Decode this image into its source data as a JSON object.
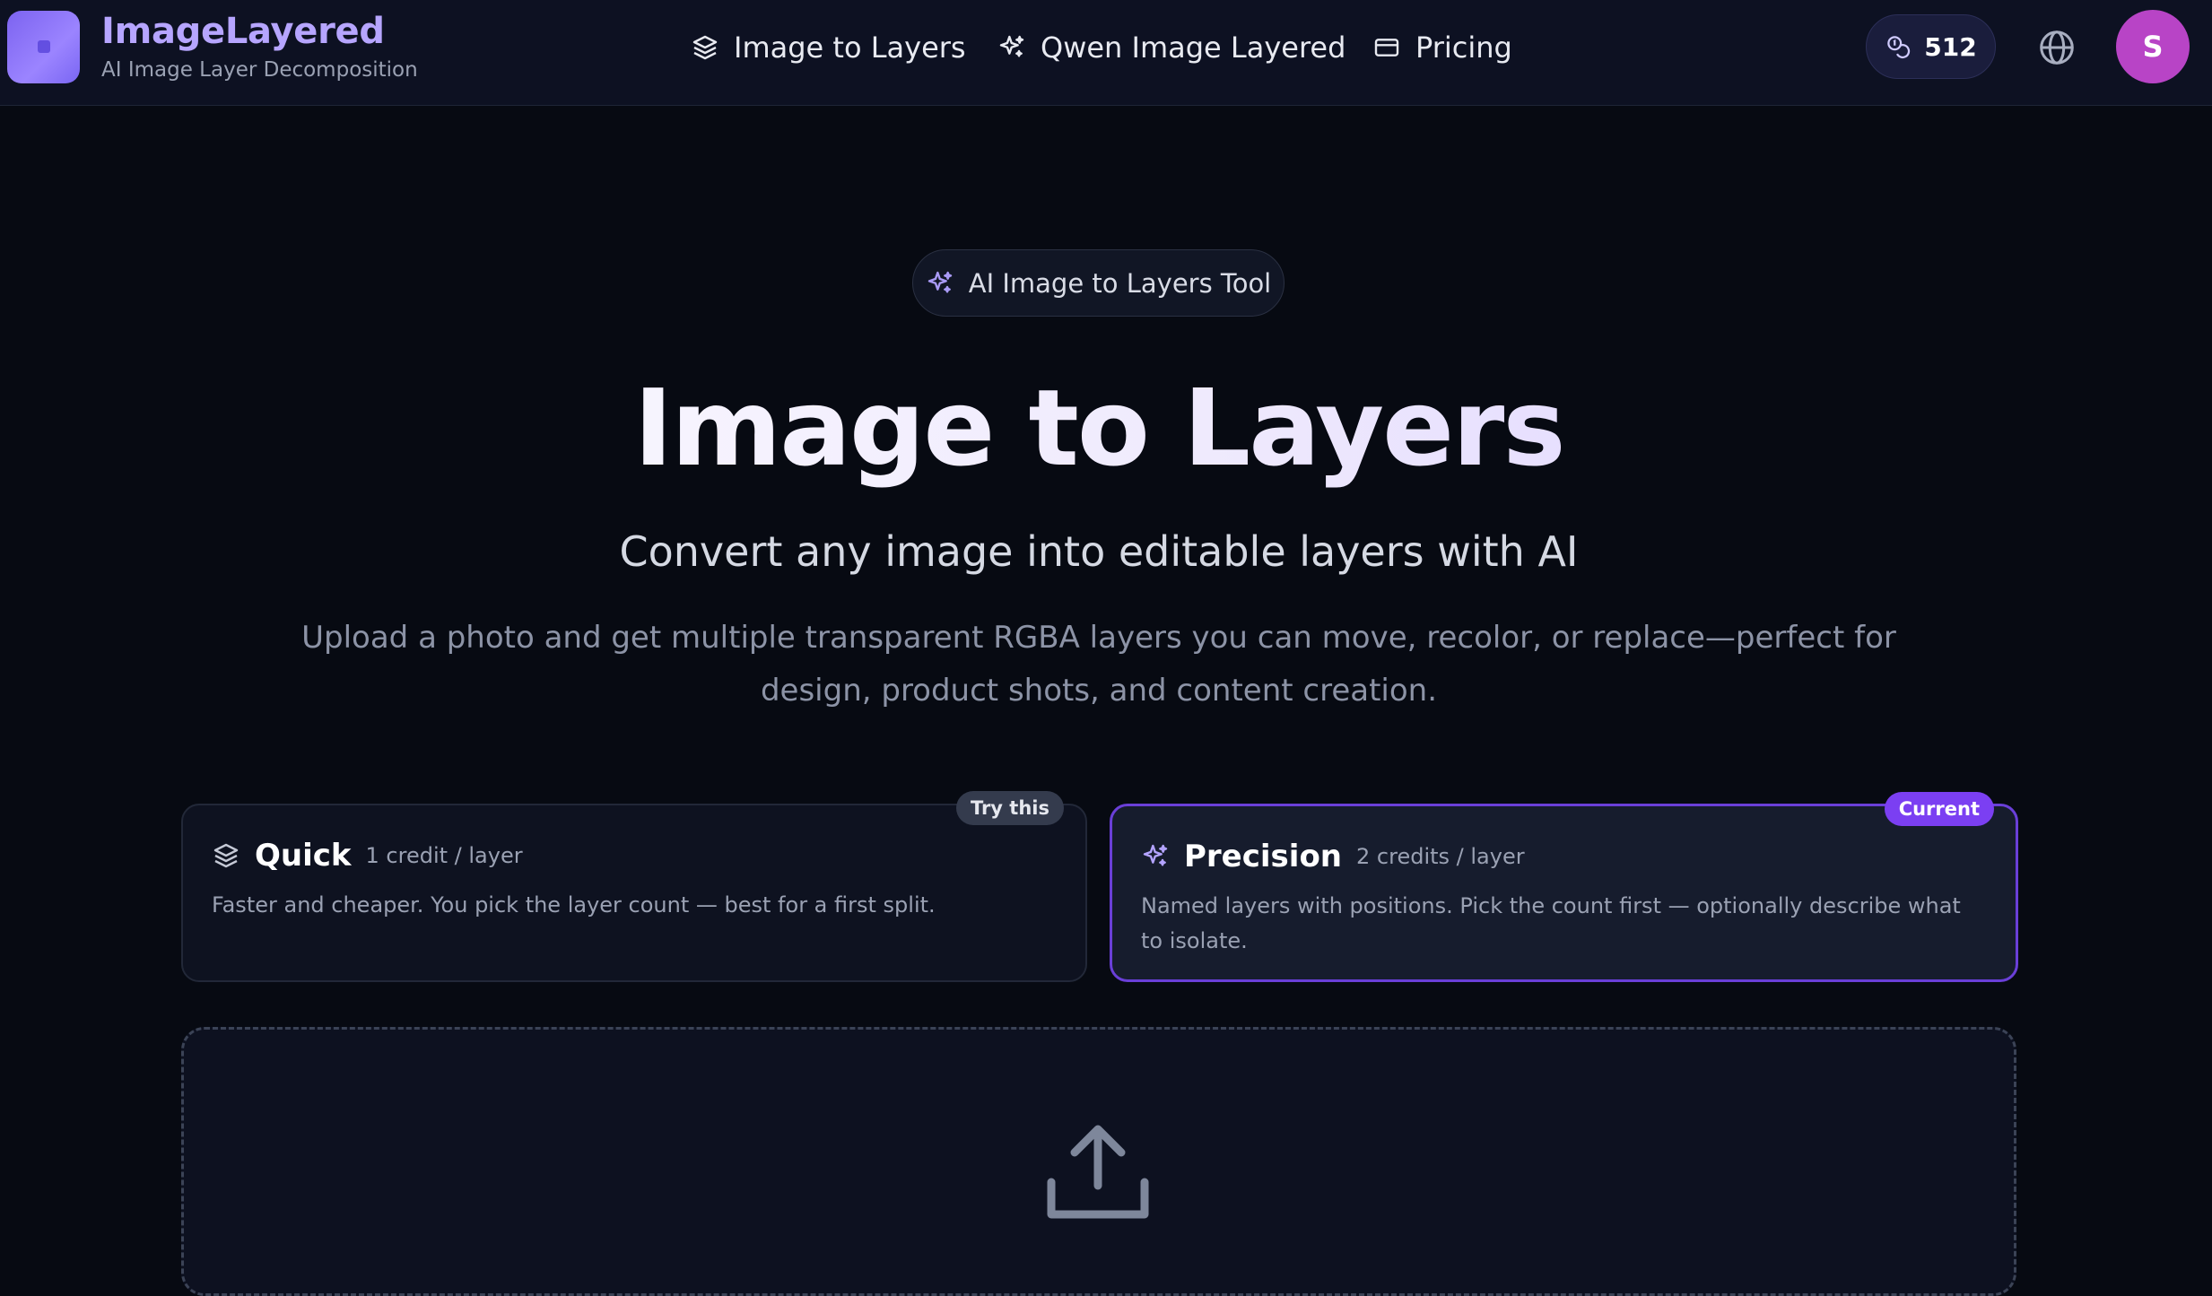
{
  "brand": {
    "name": "ImageLayered",
    "tagline": "AI Image Layer Decomposition"
  },
  "nav": {
    "links": [
      {
        "label": "Image to Layers",
        "icon": "layers-icon"
      },
      {
        "label": "Qwen Image Layered",
        "icon": "sparkles-icon"
      },
      {
        "label": "Pricing",
        "icon": "credit-card-icon"
      }
    ],
    "credits": "512",
    "avatar_initial": "S"
  },
  "hero": {
    "pill_label": "AI Image to Layers Tool",
    "title": "Image to Layers",
    "subtitle": "Convert any image into editable layers with AI",
    "description": "Upload a photo and get multiple transparent RGBA layers you can move, recolor, or replace—perfect for design, product shots, and content creation."
  },
  "modes": [
    {
      "name": "Quick",
      "cost": "1 credit / layer",
      "description": "Faster and cheaper. You pick the layer count — best for a first split.",
      "badge": "Try this",
      "selected": false
    },
    {
      "name": "Precision",
      "cost": "2 credits / layer",
      "description": "Named layers with positions. Pick the count first — optionally describe what to isolate.",
      "badge": "Current",
      "selected": true
    }
  ],
  "colors": {
    "accent": "#7b3ff2",
    "brand": "#b6a5ff",
    "background": "#070a12",
    "avatar": "#b844c6"
  }
}
